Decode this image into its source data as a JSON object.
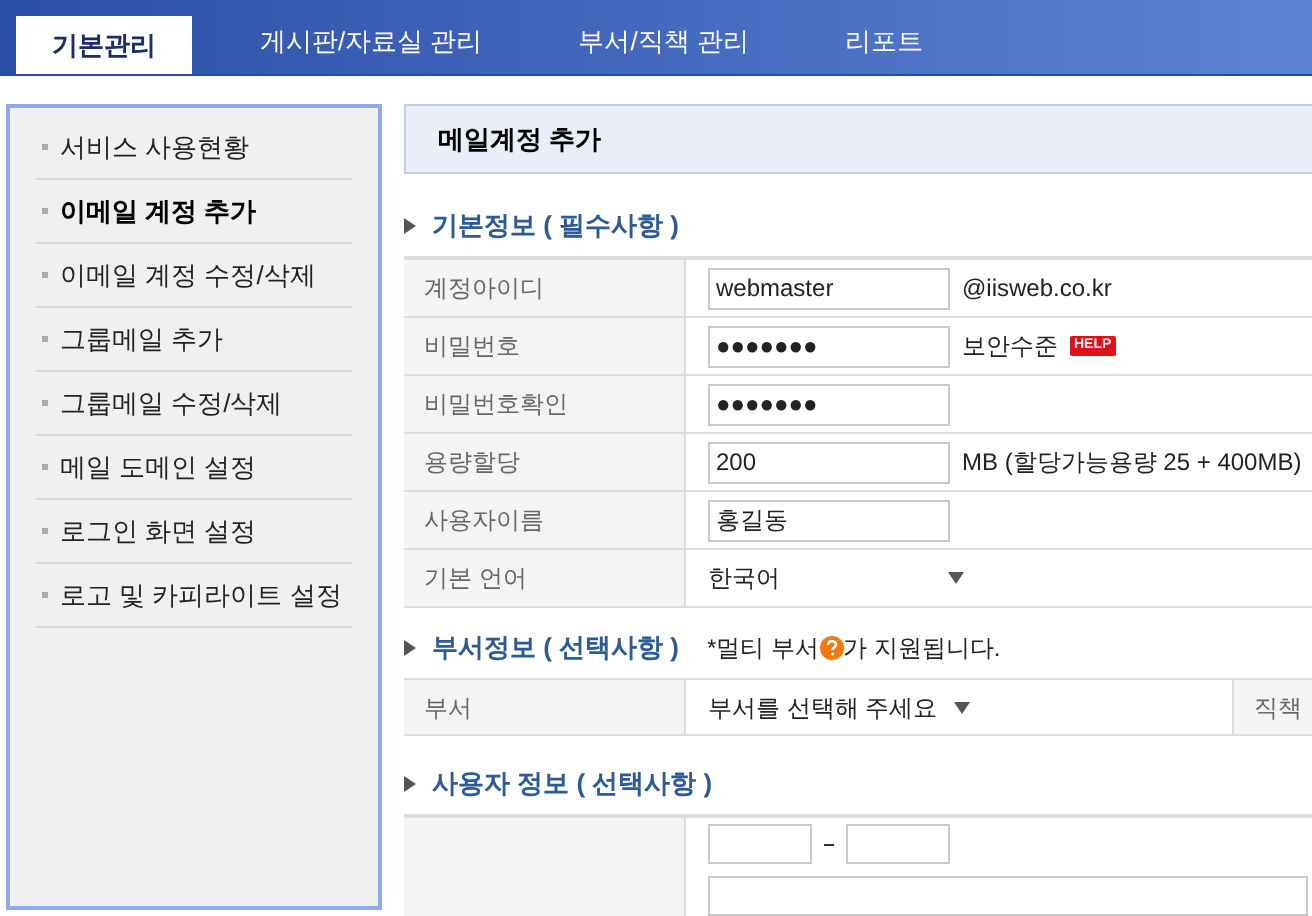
{
  "tabs": [
    {
      "label": "기본관리",
      "selected": true
    },
    {
      "label": "게시판/자료실 관리",
      "selected": false
    },
    {
      "label": "부서/직책 관리",
      "selected": false
    },
    {
      "label": "리포트",
      "selected": false
    }
  ],
  "sidebar": {
    "items": [
      {
        "label": "서비스 사용현황",
        "selected": false
      },
      {
        "label": "이메일 계정 추가",
        "selected": true
      },
      {
        "label": "이메일 계정 수정/삭제",
        "selected": false
      },
      {
        "label": "그룹메일 추가",
        "selected": false
      },
      {
        "label": "그룹메일 수정/삭제",
        "selected": false
      },
      {
        "label": "메일 도메인 설정",
        "selected": false
      },
      {
        "label": "로그인 화면 설정",
        "selected": false
      },
      {
        "label": "로고 및 카피라이트 설정",
        "selected": false
      }
    ]
  },
  "page_title": "메일계정 추가",
  "basic_section": {
    "title": "기본정보 ( 필수사항 )",
    "rows": [
      {
        "kind": "input",
        "label": "계정아이디",
        "value": "webmaster",
        "note": "@iisweb.co.kr"
      },
      {
        "kind": "input",
        "label": "비밀번호",
        "value": "●●●●●●●",
        "note": "보안수준",
        "badge": "HELP"
      },
      {
        "kind": "input",
        "label": "비밀번호확인",
        "value": "●●●●●●●"
      },
      {
        "kind": "input",
        "label": "용량할당",
        "value": "200",
        "note": "MB (할당가능용량 25 + 400MB)"
      },
      {
        "kind": "input",
        "label": "사용자이름",
        "value": "홍길동"
      },
      {
        "kind": "select",
        "label": "기본 언어",
        "value": "한국어"
      }
    ]
  },
  "dept_section": {
    "title": "부서정보 ( 선택사항 )",
    "note_before": "*멀티 부서",
    "note_after": "가 지원됩니다.",
    "label": "부서",
    "select": "부서를 선택해 주세요",
    "label_2": "직책"
  },
  "user_section": {
    "title": "사용자 정보 ( 선택사항 )"
  }
}
